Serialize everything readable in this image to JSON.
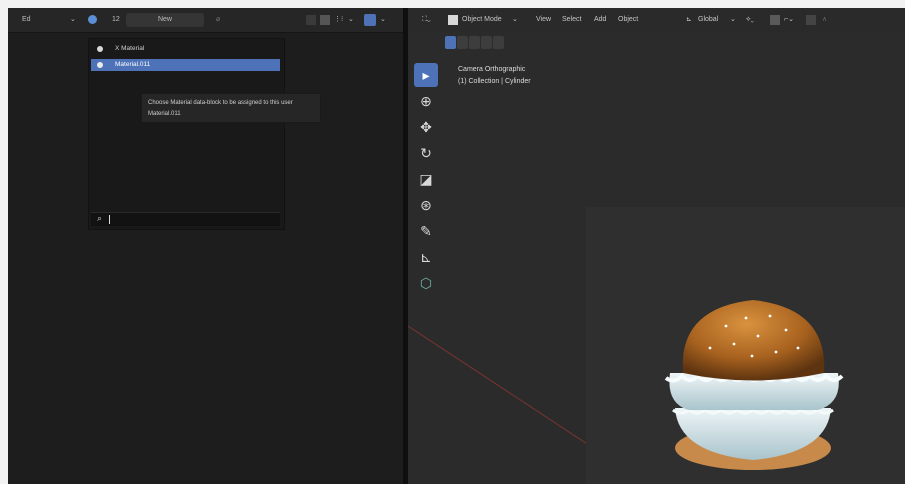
{
  "left_header": {
    "editor_type": "Ed",
    "datablock_users": "12",
    "new_label": "New"
  },
  "material_popup": {
    "items": [
      {
        "label": "X Material",
        "selected": false
      },
      {
        "label": "Material.011",
        "selected": true
      }
    ],
    "tooltip_line1": "Choose Material data-block to be assigned to this user",
    "tooltip_line2": "Material.011",
    "search_value": ""
  },
  "viewport_header": {
    "mode": "Object Mode",
    "menus": [
      "View",
      "Select",
      "Add",
      "Object"
    ],
    "orientation": "Global"
  },
  "viewport_overlay": {
    "view_name": "Camera Orthographic",
    "collection": "(1) Collection | Cylinder"
  },
  "tools": [
    {
      "name": "select-box-icon",
      "glyph": "▸",
      "active": true
    },
    {
      "name": "cursor-icon",
      "glyph": "⊕",
      "active": false
    },
    {
      "name": "move-icon",
      "glyph": "✥",
      "active": false
    },
    {
      "name": "rotate-icon",
      "glyph": "↻",
      "active": false
    },
    {
      "name": "scale-icon",
      "glyph": "◪",
      "active": false
    },
    {
      "name": "transform-icon",
      "glyph": "⊛",
      "active": false
    },
    {
      "name": "annotate-icon",
      "glyph": "✎",
      "active": false
    },
    {
      "name": "measure-icon",
      "glyph": "⊾",
      "active": false
    },
    {
      "name": "add-cube-icon",
      "glyph": "⬡",
      "active": false
    }
  ],
  "colors": {
    "accent": "#4d72b8",
    "bun": "#b5702e",
    "frosting": "#c8dde2"
  }
}
